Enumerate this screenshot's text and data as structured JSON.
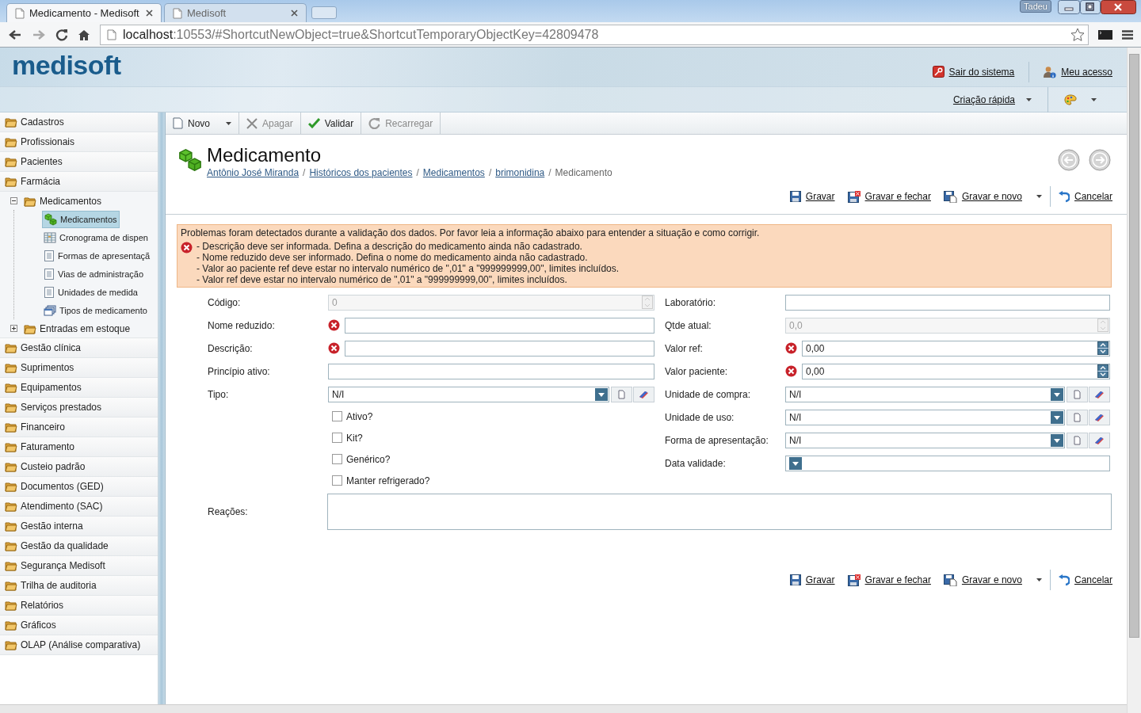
{
  "browser": {
    "tabs": [
      {
        "title": "Medicamento - Medisoft",
        "selected": true
      },
      {
        "title": "Medisoft",
        "selected": false
      }
    ],
    "user": "Tadeu",
    "url_host": "localhost",
    "url_rest": ":10553/#ShortcutNewObject=true&ShortcutTemporaryObjectKey=42809478"
  },
  "header": {
    "logo": "medisoft",
    "links": [
      {
        "label": "Sair do sistema",
        "kind": "logout"
      },
      {
        "label": "Meu acesso",
        "kind": "user"
      }
    ],
    "quick_create": "Criação rápida"
  },
  "sidebar": {
    "items": [
      {
        "label": "Cadastros",
        "selected": false
      },
      {
        "label": "Profissionais",
        "selected": false
      },
      {
        "label": "Pacientes",
        "selected": false
      },
      {
        "label": "Farmácia",
        "selected": false,
        "children": [
          {
            "label": "Medicamentos",
            "selected": false,
            "expanded": true,
            "children": [
              {
                "label": "Medicamentos",
                "kind": "drug",
                "selected": true
              },
              {
                "label": "Cronograma de dispen",
                "kind": "grid",
                "selected": false
              },
              {
                "label": "Formas de apresentaçã",
                "kind": "doc",
                "selected": false
              },
              {
                "label": "Vias de administração",
                "kind": "doc",
                "selected": false
              },
              {
                "label": "Unidades de medida",
                "kind": "doc",
                "selected": false
              },
              {
                "label": "Tipos de medicamento",
                "kind": "stack",
                "selected": false
              }
            ]
          },
          {
            "label": "Entradas em estoque",
            "selected": false,
            "expanded": false
          }
        ]
      },
      {
        "label": "Gestão clínica",
        "selected": false
      },
      {
        "label": "Suprimentos",
        "selected": false
      },
      {
        "label": "Equipamentos",
        "selected": false
      },
      {
        "label": "Serviços prestados",
        "selected": false
      },
      {
        "label": "Financeiro",
        "selected": false
      },
      {
        "label": "Faturamento",
        "selected": false
      },
      {
        "label": "Custeio padrão",
        "selected": false
      },
      {
        "label": "Documentos (GED)",
        "selected": false
      },
      {
        "label": "Atendimento (SAC)",
        "selected": false
      },
      {
        "label": "Gestão interna",
        "selected": false
      },
      {
        "label": "Gestão da qualidade",
        "selected": false
      },
      {
        "label": "Segurança Medisoft",
        "selected": false
      },
      {
        "label": "Trilha de auditoria",
        "selected": false
      },
      {
        "label": "Relatórios",
        "selected": false
      },
      {
        "label": "Gráficos",
        "selected": false
      },
      {
        "label": "OLAP (Análise comparativa)",
        "selected": false
      }
    ]
  },
  "toolbar": [
    {
      "label": "Novo",
      "kind": "new",
      "disabled": false,
      "has_menu": true
    },
    {
      "label": "Apagar",
      "kind": "delete",
      "disabled": true,
      "has_menu": false
    },
    {
      "label": "Validar",
      "kind": "validate",
      "disabled": false,
      "has_menu": false
    },
    {
      "label": "Recarregar",
      "kind": "reload",
      "disabled": true,
      "has_menu": false
    }
  ],
  "page": {
    "title": "Medicamento",
    "breadcrumb": [
      {
        "label": "Antônio José Miranda",
        "kind": "link"
      },
      {
        "label": "/",
        "kind": "separator"
      },
      {
        "label": "Históricos dos pacientes",
        "kind": "link"
      },
      {
        "label": "/",
        "kind": "separator"
      },
      {
        "label": "Medicamentos",
        "kind": "link"
      },
      {
        "label": "/",
        "kind": "separator"
      },
      {
        "label": "brimonidina",
        "kind": "link"
      },
      {
        "label": "/",
        "kind": "separator"
      },
      {
        "label": "Medicamento",
        "kind": "current"
      }
    ],
    "actions_top": [
      {
        "label": "Gravar",
        "kind": "save",
        "has_menu": false
      },
      {
        "label": "Gravar e fechar",
        "kind": "save_close",
        "has_menu": false
      },
      {
        "label": "Gravar e novo",
        "kind": "save_new",
        "has_menu": true
      },
      {
        "label": "Cancelar",
        "kind": "cancel",
        "has_menu": false
      }
    ],
    "validation": {
      "intro": "Problemas foram detectados durante a validação dos dados. Por favor leia a informação abaixo para entender a situação e como corrigir.",
      "errors": [
        "- Descrição deve ser informada. Defina a descrição do medicamento ainda não cadastrado.",
        "- Nome reduzido deve ser informado. Defina o nome do medicamento ainda não cadastrado.",
        "- Valor ao paciente ref deve estar no intervalo numérico de \",01\" a \"999999999,00\", limites incluídos.",
        "- Valor ref deve estar no intervalo numérico de \",01\" a \"999999999,00\", limites incluídos."
      ]
    },
    "form_left": [
      {
        "label": "Código:",
        "kind": "spin",
        "value": "0",
        "disabled": true,
        "error": false
      },
      {
        "label": "Nome reduzido:",
        "kind": "text",
        "error": true
      },
      {
        "label": "Descrição:",
        "kind": "text",
        "error": true
      },
      {
        "label": "Princípio ativo:",
        "kind": "text",
        "error": false
      },
      {
        "label": "Tipo:",
        "kind": "select",
        "value": "N/I",
        "error": false
      },
      {
        "label": "Ativo?",
        "kind": "check",
        "checked": false
      },
      {
        "label": "Kit?",
        "kind": "check",
        "checked": false
      },
      {
        "label": "Genérico?",
        "kind": "check",
        "checked": false
      },
      {
        "label": "Manter refrigerado?",
        "kind": "check",
        "checked": false
      }
    ],
    "form_right": [
      {
        "label": "Laboratório:",
        "kind": "text",
        "error": false
      },
      {
        "label": "Qtde atual:",
        "kind": "spin",
        "value": "0,0",
        "disabled": true,
        "error": false
      },
      {
        "label": "Valor ref:",
        "kind": "spin",
        "value": "0,00",
        "disabled": false,
        "error": true
      },
      {
        "label": "Valor paciente:",
        "kind": "spin",
        "value": "0,00",
        "disabled": false,
        "error": true
      },
      {
        "label": "Unidade de compra:",
        "kind": "select",
        "value": "N/I",
        "error": false
      },
      {
        "label": "Unidade de uso:",
        "kind": "select",
        "value": "N/I",
        "error": false
      },
      {
        "label": "Forma de apresentação:",
        "kind": "select",
        "value": "N/I",
        "error": false
      },
      {
        "label": "Data validade:",
        "kind": "date",
        "error": false
      }
    ],
    "reactions": {
      "label": "Reações:"
    },
    "actions_bottom": [
      {
        "label": "Gravar",
        "kind": "save",
        "has_menu": false
      },
      {
        "label": "Gravar e fechar",
        "kind": "save_close",
        "has_menu": false
      },
      {
        "label": "Gravar e novo",
        "kind": "save_new",
        "has_menu": true
      },
      {
        "label": "Cancelar",
        "kind": "cancel",
        "has_menu": false
      }
    ]
  }
}
